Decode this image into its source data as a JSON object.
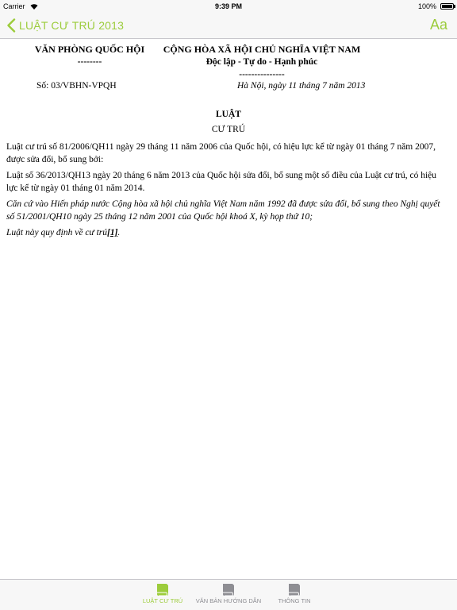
{
  "status_bar": {
    "carrier": "Carrier",
    "time": "9:39 PM",
    "battery": "100%"
  },
  "nav": {
    "back_label": "LUẬT CƯ TRÚ 2013",
    "font_button": "Aa"
  },
  "document": {
    "org_name": "VĂN PHÒNG QUỐC HỘI",
    "org_divider": "--------",
    "country_name": "CỘNG HÒA XÃ HỘI CHỦ NGHĨA VIỆT NAM",
    "motto": "Độc lập - Tự do - Hạnh phúc",
    "motto_divider": "---------------",
    "doc_number": "Số: 03/VBHN-VPQH",
    "doc_date": "Hà Nội, ngày 11 tháng 7 năm 2013",
    "title": "LUẬT",
    "subtitle": "CƯ TRÚ",
    "paragraph_1": "Luật cư trú số 81/2006/QH11 ngày 29 tháng 11 năm 2006 của Quốc hội, có hiệu lực kể từ ngày 01 tháng 7 năm 2007, được sửa đổi, bổ sung bởi:",
    "paragraph_2": "Luật số 36/2013/QH13 ngày 20 tháng 6 năm 2013 của Quốc hội sửa đổi, bổ sung một số điều của Luật cư trú, có hiệu lực kể từ ngày 01 tháng 01 năm 2014.",
    "paragraph_3": "Căn cứ vào Hiến pháp nước Cộng hòa xã hội chủ nghĩa Việt Nam năm 1992 đã được sửa đổi, bổ sung theo Nghị quyết số 51/2001/QH10 ngày 25 tháng 12 năm 2001 của Quốc hội khoá X, kỳ họp thứ 10;",
    "paragraph_4": "Luật này quy định về cư trú",
    "footnote_link": "[1]",
    "paragraph_4_end": "."
  },
  "tab_bar": {
    "tabs": [
      {
        "label": "LUẬT CƯ TRÚ",
        "active": true
      },
      {
        "label": "VĂN BẢN HƯỚNG DẪN",
        "active": false
      },
      {
        "label": "THÔNG TIN",
        "active": false
      }
    ]
  },
  "colors": {
    "accent": "#9ccc3c",
    "inactive": "#8e8e93"
  }
}
